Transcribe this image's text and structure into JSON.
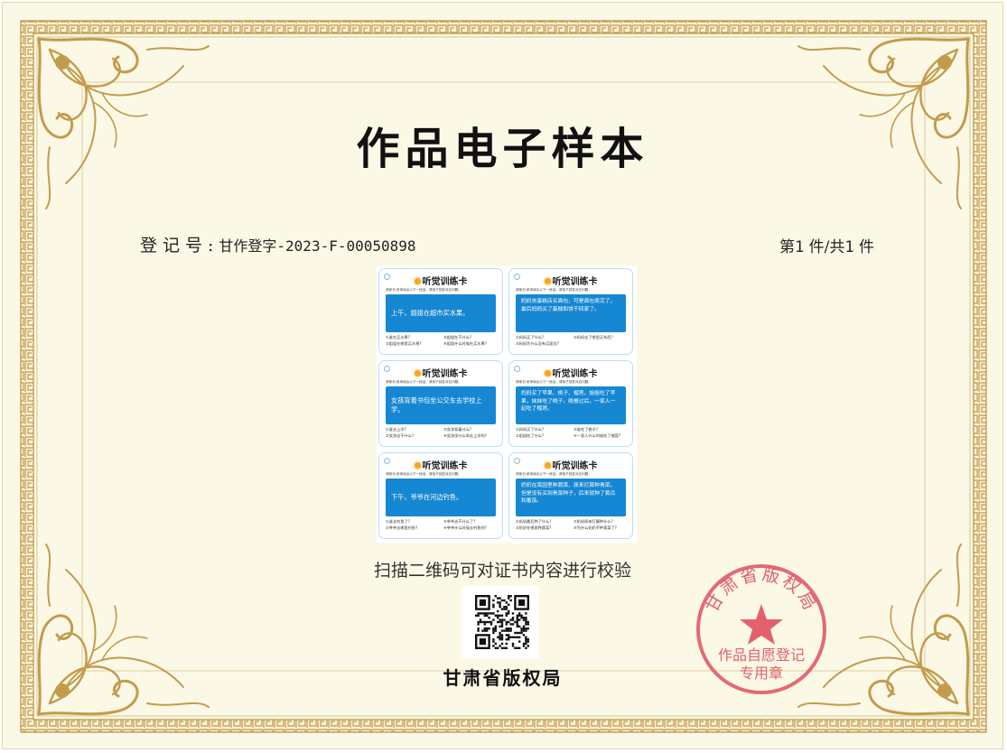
{
  "certificate": {
    "title": "作品电子样本",
    "registration_label": "登记号:",
    "registration_number": "甘作登字-2023-F-00050898",
    "page_prefix": "第",
    "page_current": "1",
    "page_mid": "件/共",
    "page_total": "1",
    "page_suffix": "件",
    "verify_text": "扫描二维码可对证书内容进行校验",
    "issuer": "甘肃省版权局",
    "seal": {
      "top_text": "甘肃省版权局",
      "line1": "作品自愿登记",
      "line2": "专用章",
      "color": "#e0505f"
    },
    "colors": {
      "paper": "#fbf8e6",
      "frame_gold": "#c9a45c",
      "card_blue": "#1687d2"
    }
  },
  "sample": {
    "cards": [
      {
        "title": "听觉训练卡",
        "instruction": "请家长/老师读出以下一段话，请孩子回答对应问题。",
        "story": "上午，姐姐在超市买水果。",
        "questions": [
          "①谁在买水果?",
          "③姐姐在干什么?",
          "②姐姐在哪里买水果?",
          "④姐姐什么时候在买水果?"
        ]
      },
      {
        "title": "听觉训练卡",
        "instruction": "请家长/老师读出以下一段话，请孩子回答对应问题。",
        "story": "妈妈去蛋糕店买面包，可是面包卖完了。最后妈妈买了蛋糕和饼干回家了。",
        "questions": [
          "①妈妈买了什么?",
          "③妈妈去了哪里买东西?",
          "②妈妈为什么没有买面包?",
          ""
        ]
      },
      {
        "title": "听觉训练卡",
        "instruction": "请家长/老师读出以下一段话，请孩子回答对应问题。",
        "story": "女孩背着书包坐公交车去学校上学。",
        "questions": [
          "①谁去上学?",
          "③女孩背着什么?",
          "②女孩去干什么?",
          "④女孩坐什么车去上学的?"
        ]
      },
      {
        "title": "听觉训练卡",
        "instruction": "请家长/老师读出以下一段话，请孩子回答对应问题。",
        "story": "妈妈买了苹果、桃子、榴莲。姐姐吃了苹果，妹妹吃了桃子。晚餐过后，一家人一起吃了榴莲。",
        "questions": [
          "①妈妈买了什么?",
          "③谁吃了桃子?",
          "②姐姐吃了什么?",
          "④一家人什么时候吃了榴莲?"
        ]
      },
      {
        "title": "听觉训练卡",
        "instruction": "请家长/老师读出以下一段话，请孩子回答对应问题。",
        "story": "下午，爷爷在河边钓鱼。",
        "questions": [
          "①谁去钓鱼了?",
          "③爷爷去干什么了?",
          "②爷爷去哪里钓鱼?",
          "④爷爷什么时候去钓鱼的?"
        ]
      },
      {
        "title": "听觉训练卡",
        "instruction": "请家长/老师读出以下一段话，请孩子回答对应问题。",
        "story": "奶奶在菜园里种蔬菜，原来打算种青菜，但是没有买到青菜种子，后来就种了黄瓜和番茄。",
        "questions": [
          "①奶奶最后种了什么?",
          "③奶奶原来打算种什么?",
          "②奶奶在哪里种蔬菜?",
          "④为什么奶奶不种青菜了?"
        ]
      }
    ]
  }
}
